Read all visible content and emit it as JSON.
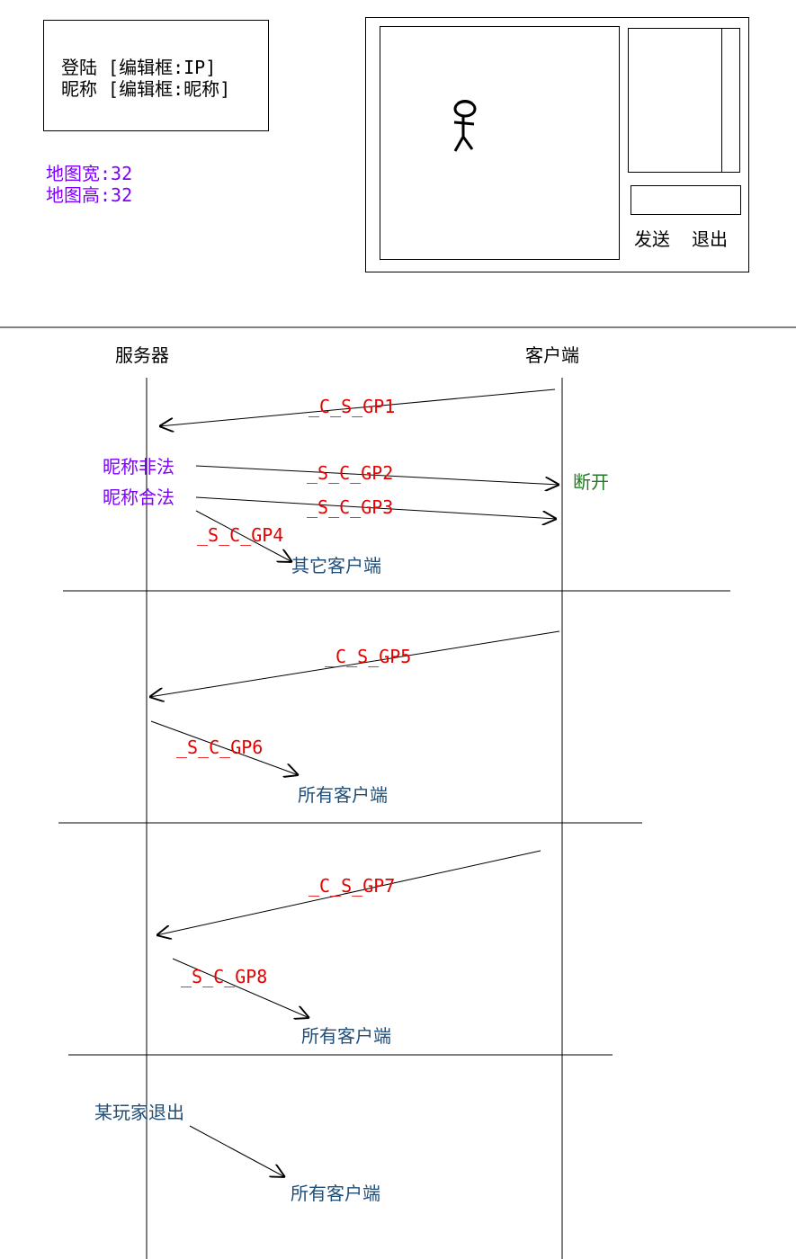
{
  "login_box": {
    "line1": "登陆 [编辑框:IP]",
    "line2": "昵称 [编辑框:昵称]"
  },
  "map_info": {
    "width_label": "地图宽:32",
    "height_label": "地图高:32"
  },
  "game_window": {
    "send_button": "发送",
    "exit_button": "退出"
  },
  "sequence": {
    "server_label": "服务器",
    "client_label": "客户端",
    "messages": {
      "gp1": "_C_S_GP1",
      "gp2": "_S_C_GP2",
      "gp3": "_S_C_GP3",
      "gp4": "_S_C_GP4",
      "gp5": "_C_S_GP5",
      "gp6": "_S_C_GP6",
      "gp7": "_C_S_GP7",
      "gp8": "_S_C_GP8"
    },
    "notes": {
      "nick_invalid": "昵称非法",
      "nick_valid": "昵称合法",
      "disconnect": "断开",
      "other_clients": "其它客户端",
      "all_clients_1": "所有客户端",
      "all_clients_2": "所有客户端",
      "all_clients_3": "所有客户端",
      "player_exit": "某玩家退出"
    }
  },
  "colors": {
    "note_purple": "#7f00ff",
    "message_red": "#e60000",
    "target_blue": "#1f4e79",
    "disconnect_green": "#217a21"
  }
}
